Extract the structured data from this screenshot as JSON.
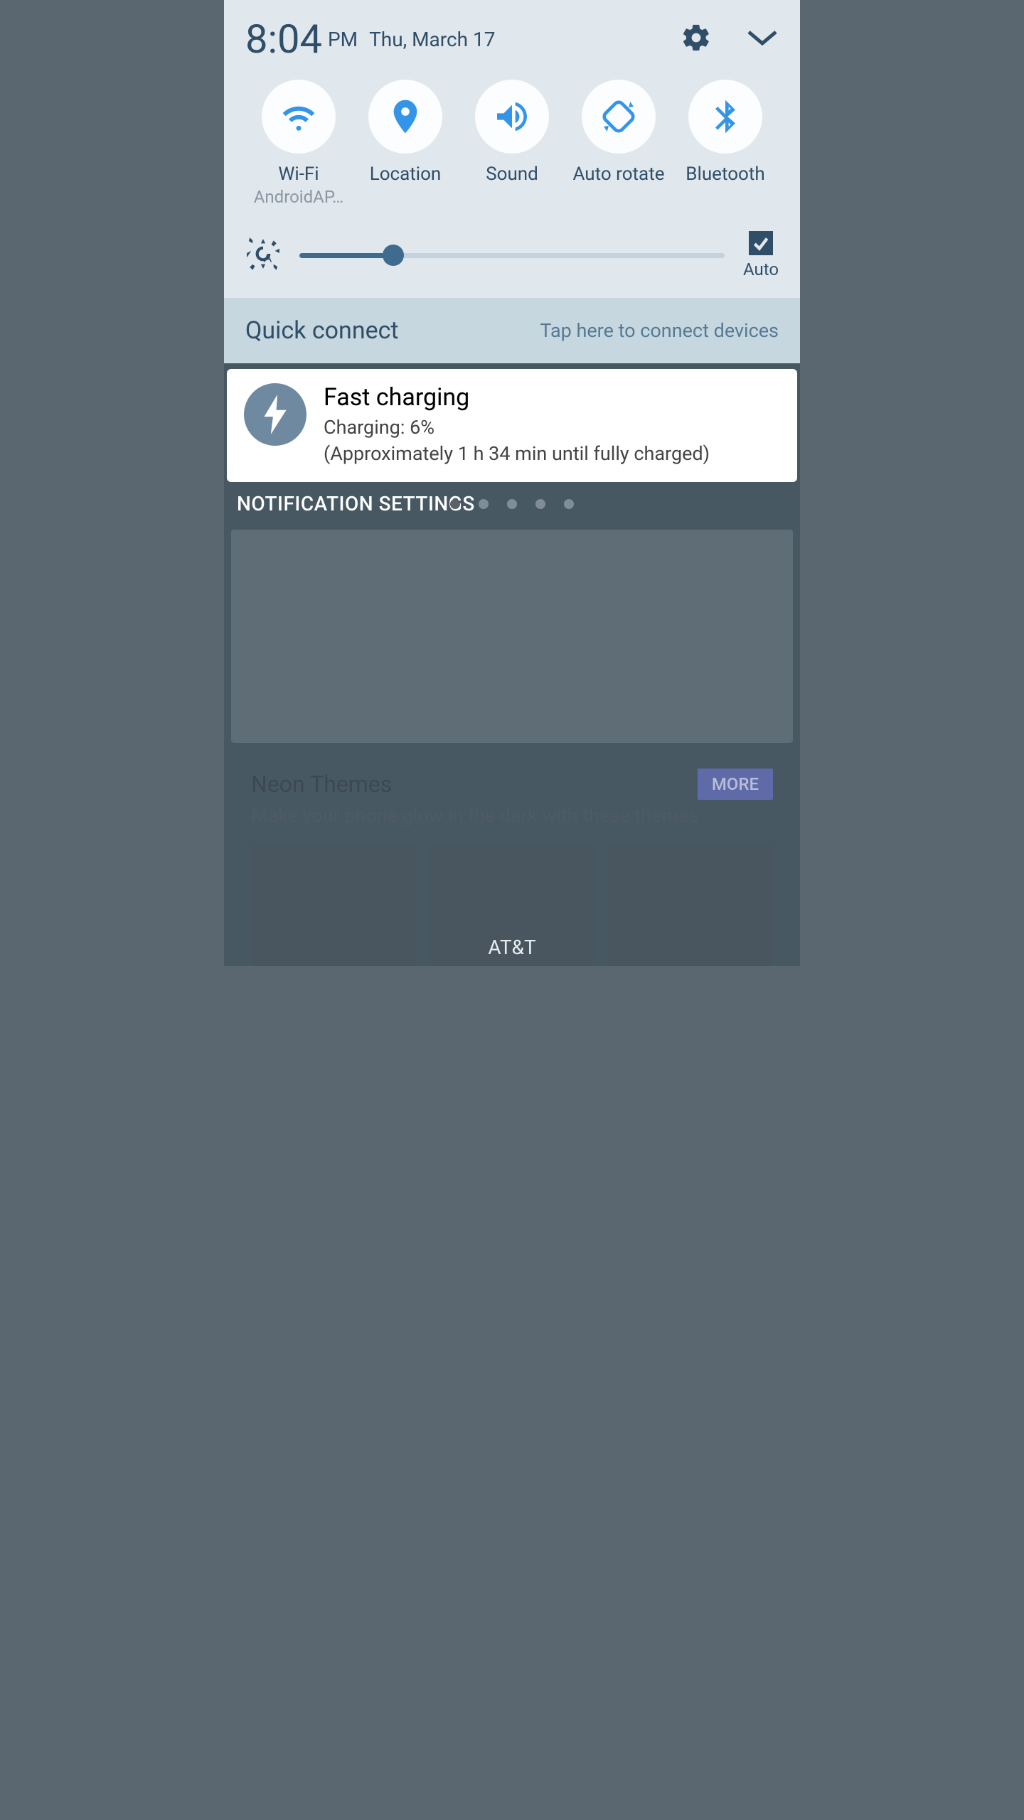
{
  "status": {
    "time": "8:04",
    "ampm": "PM",
    "date": "Thu, March 17"
  },
  "tiles": [
    {
      "label": "Wi-Fi",
      "sub": "AndroidAP…"
    },
    {
      "label": "Location",
      "sub": ""
    },
    {
      "label": "Sound",
      "sub": ""
    },
    {
      "label": "Auto rotate",
      "sub": ""
    },
    {
      "label": "Bluetooth",
      "sub": ""
    }
  ],
  "brightness": {
    "percent": 22,
    "auto_label": "Auto",
    "auto_checked": true
  },
  "quick_connect": {
    "title": "Quick connect",
    "hint": "Tap here to connect devices"
  },
  "notification": {
    "title": "Fast charging",
    "line1": "Charging: 6%",
    "line2": "(Approximately 1 h 34 min until fully charged)"
  },
  "notif_settings_label": "NOTIFICATION SETTINGS",
  "themes": {
    "title": "Neon Themes",
    "subtitle": "Make your phone glow in the dark with these themes",
    "more": "MORE"
  },
  "carrier": "AT&T"
}
